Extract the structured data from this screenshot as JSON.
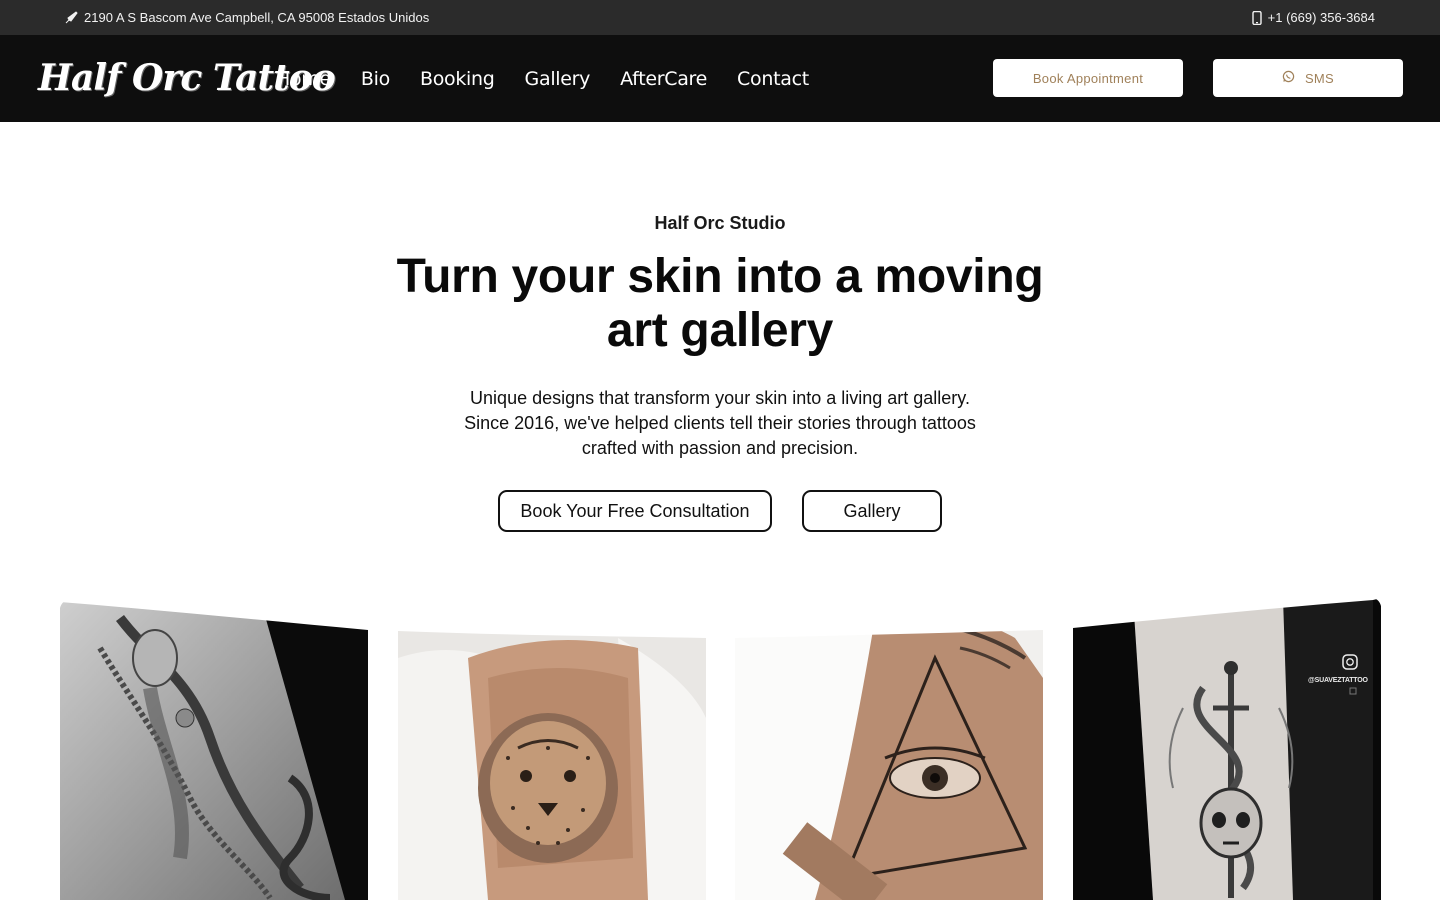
{
  "topbar": {
    "address": "2190 A S Bascom Ave Campbell, CA 95008 Estados Unidos",
    "phone": "+1 (669) 356-3684",
    "address_icon": "tattoo-needle-icon",
    "phone_icon": "mobile-phone-icon"
  },
  "nav": {
    "logo_text": "Half Orc Tattoo",
    "items": [
      "Home",
      "Bio",
      "Booking",
      "Gallery",
      "AfterCare",
      "Contact"
    ],
    "book_appointment": "Book Appointment",
    "sms": "SMS",
    "sms_icon": "whatsapp-icon"
  },
  "hero": {
    "kicker": "Half Orc Studio",
    "headline": "Turn your skin into a moving art gallery",
    "description": "Unique designs that transform your skin into a living art gallery. Since 2016, we've helped clients tell their stories through tattoos crafted with passion and precision.",
    "cta_primary": "Book Your Free Consultation",
    "cta_secondary": "Gallery"
  },
  "gallery": {
    "images": [
      {
        "name": "tattoo-woman-snake-image"
      },
      {
        "name": "tattoo-cheetah-image"
      },
      {
        "name": "tattoo-eye-triangle-image"
      },
      {
        "name": "tattoo-skull-sword-snake-image"
      }
    ],
    "overlay_handle": "@SUAVEZTATTOO"
  },
  "colors": {
    "topbar_bg": "#2b2b2b",
    "nav_bg": "#0e0e0e",
    "accent_gold": "#a0815a"
  }
}
